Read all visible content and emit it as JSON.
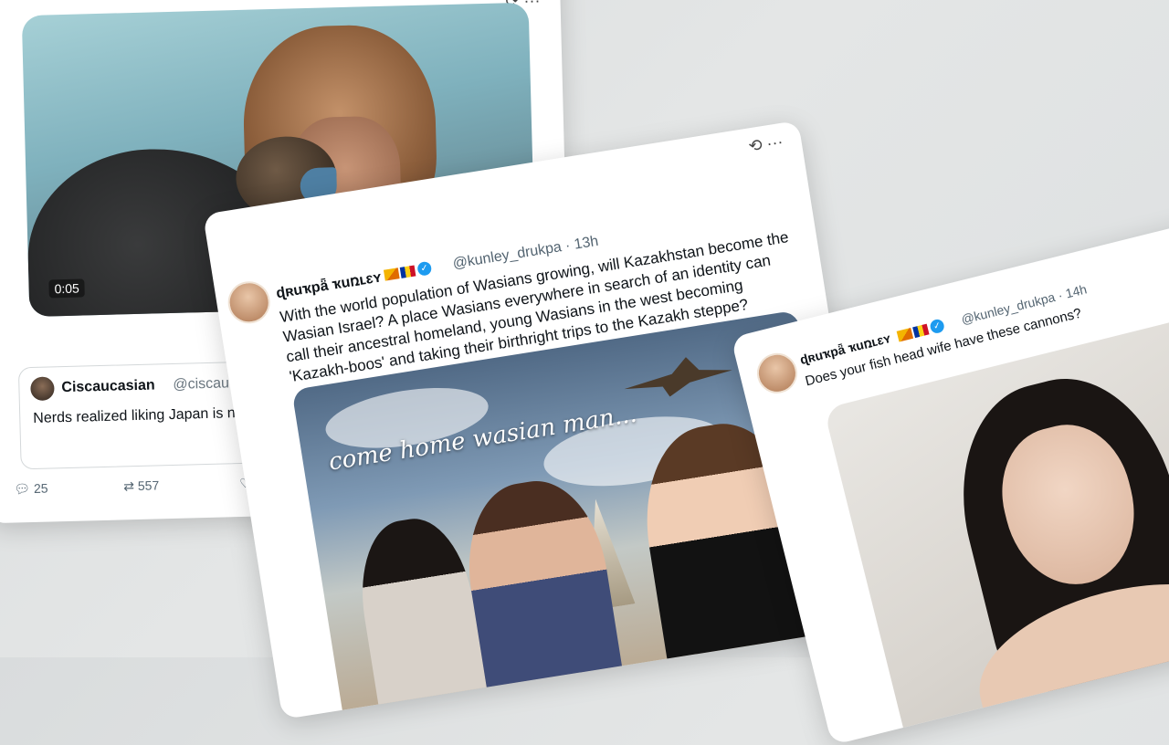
{
  "card1": {
    "video_timestamp": "0:05",
    "quote": {
      "name": "Ciscaucasian",
      "handle": "@ciscaucasi",
      "text": "Nerds realized liking Japan is no Kazakhstan"
    },
    "stats": {
      "replies": "25",
      "reposts": "557"
    },
    "icons": [
      "more-icon",
      "reply-icon",
      "repost-icon",
      "like-icon"
    ]
  },
  "card2": {
    "name": "ɖʀuҡpǟ ҡuռʟɛʏ",
    "handle": "@kunley_drukpa · 13h",
    "text": "With the world population of Wasians growing, will Kazakhstan become the Wasian Israel? A place Wasians everywhere in search of an identity can call their ancestral homeland, young Wasians in the west becoming 'Kazakh-boos' and taking their birthright trips to the Kazakh steppe?",
    "image_caption": "come home wasian man..."
  },
  "card3": {
    "name": "ɖʀuҡpǟ ҡuռʟɛʏ",
    "handle": "@kunley_drukpa · 14h",
    "text": "Does your fish head wife have these cannons?"
  },
  "colors": {
    "verified": "#1d9bf0",
    "text": "#0f1419",
    "muted": "#536471"
  }
}
